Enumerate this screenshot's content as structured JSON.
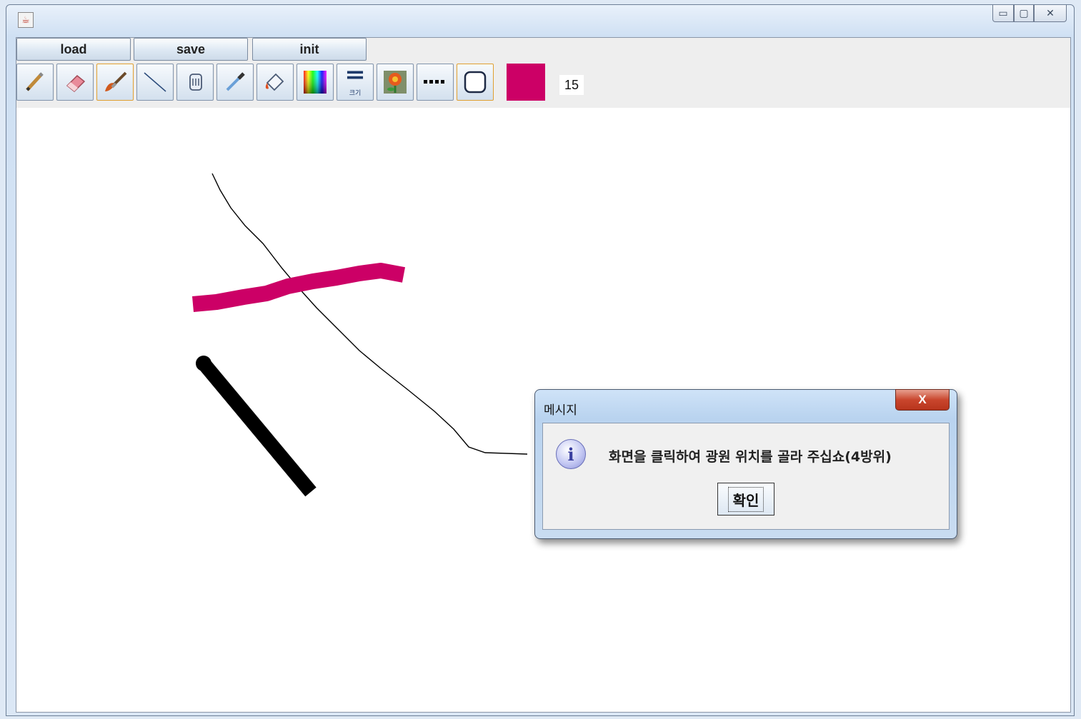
{
  "window": {
    "icon": "java-coffee-icon",
    "controls": {
      "minimize": "▭",
      "maximize": "▢",
      "close": "✕"
    }
  },
  "menu": {
    "load_label": "load",
    "save_label": "save",
    "init_label": "init"
  },
  "toolbar": {
    "tools": [
      {
        "name": "pencil-icon"
      },
      {
        "name": "eraser-icon"
      },
      {
        "name": "brush-icon"
      },
      {
        "name": "line-icon"
      },
      {
        "name": "hand-icon"
      },
      {
        "name": "eyedropper-icon"
      },
      {
        "name": "paint-bucket-icon"
      },
      {
        "name": "color-spectrum-icon"
      },
      {
        "name": "line-thickness-icon",
        "label": "크기"
      },
      {
        "name": "flower-stamp-icon"
      },
      {
        "name": "dotted-line-icon"
      },
      {
        "name": "rounded-rectangle-icon"
      }
    ],
    "current_color": "#cc0066",
    "size_value": "15"
  },
  "canvas": {
    "stroke_colors": {
      "magenta": "#cc0066",
      "black": "#000000"
    }
  },
  "dialog": {
    "title": "메시지",
    "close_label": "X",
    "icon": "info-icon",
    "icon_glyph": "i",
    "message": "화면을 클릭하여 광원 위치를 골라 주십쇼(4방위)",
    "ok_label": "확인"
  }
}
